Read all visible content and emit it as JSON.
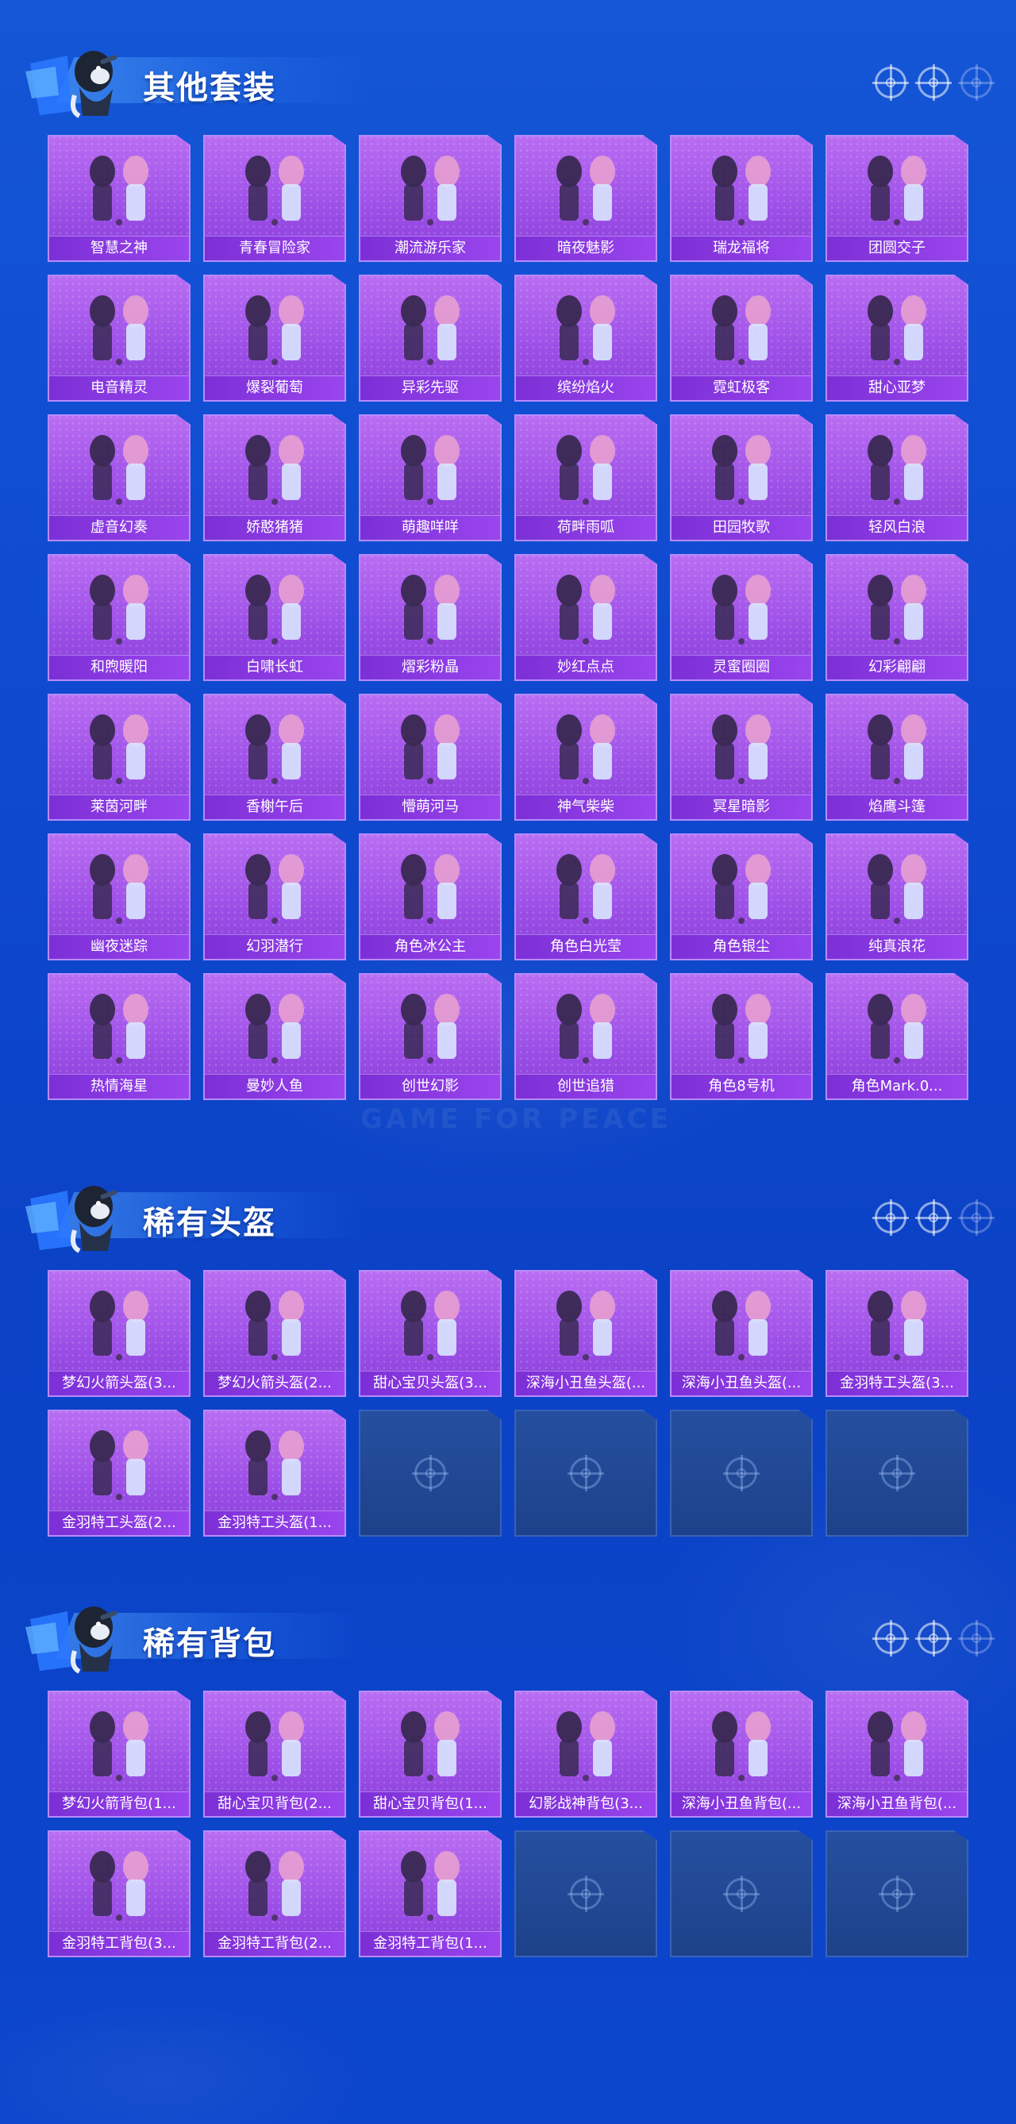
{
  "watermark": "GAME FOR PEACE",
  "sections": [
    {
      "title": "其他套装",
      "items": [
        "智慧之神",
        "青春冒险家",
        "潮流游乐家",
        "暗夜魅影",
        "瑞龙福将",
        "团圆交子",
        "电音精灵",
        "爆裂葡萄",
        "异彩先驱",
        "缤纷焰火",
        "霓虹极客",
        "甜心亚梦",
        "虚音幻奏",
        "娇憨猪猪",
        "萌趣咩咩",
        "荷畔雨呱",
        "田园牧歌",
        "轻风白浪",
        "和煦暖阳",
        "白啸长虹",
        "熠彩粉晶",
        "妙红点点",
        "灵蜜圈圈",
        "幻彩翩翩",
        "莱茵河畔",
        "香榭午后",
        "懵萌河马",
        "神气柴柴",
        "冥星暗影",
        "焰鹰斗篷",
        "幽夜迷踪",
        "幻羽潜行",
        "角色冰公主",
        "角色白光莹",
        "角色银尘",
        "纯真浪花",
        "热情海星",
        "曼妙人鱼",
        "创世幻影",
        "创世追猎",
        "角色8号机",
        "角色Mark.0..."
      ],
      "empty_slots": 0
    },
    {
      "title": "稀有头盔",
      "items": [
        "梦幻火箭头盔(3...",
        "梦幻火箭头盔(2...",
        "甜心宝贝头盔(3...",
        "深海小丑鱼头盔(...",
        "深海小丑鱼头盔(...",
        "金羽特工头盔(3...",
        "金羽特工头盔(2...",
        "金羽特工头盔(1..."
      ],
      "empty_slots": 4
    },
    {
      "title": "稀有背包",
      "items": [
        "梦幻火箭背包(1...",
        "甜心宝贝背包(2...",
        "甜心宝贝背包(1...",
        "幻影战神背包(3...",
        "深海小丑鱼背包(...",
        "深海小丑鱼背包(...",
        "金羽特工背包(3...",
        "金羽特工背包(2...",
        "金羽特工背包(1..."
      ],
      "empty_slots": 3
    }
  ],
  "colors": {
    "card_bg": "#a55cec",
    "card_border": "#b78bff",
    "label_bg": "#8a3ae2",
    "empty_bg": "#234a97",
    "page_bg": "#1150d2"
  },
  "icons": {
    "header_decor": "crosshair-icon",
    "empty_slot": "crosshair-icon",
    "mascot": "mascot-icon"
  }
}
